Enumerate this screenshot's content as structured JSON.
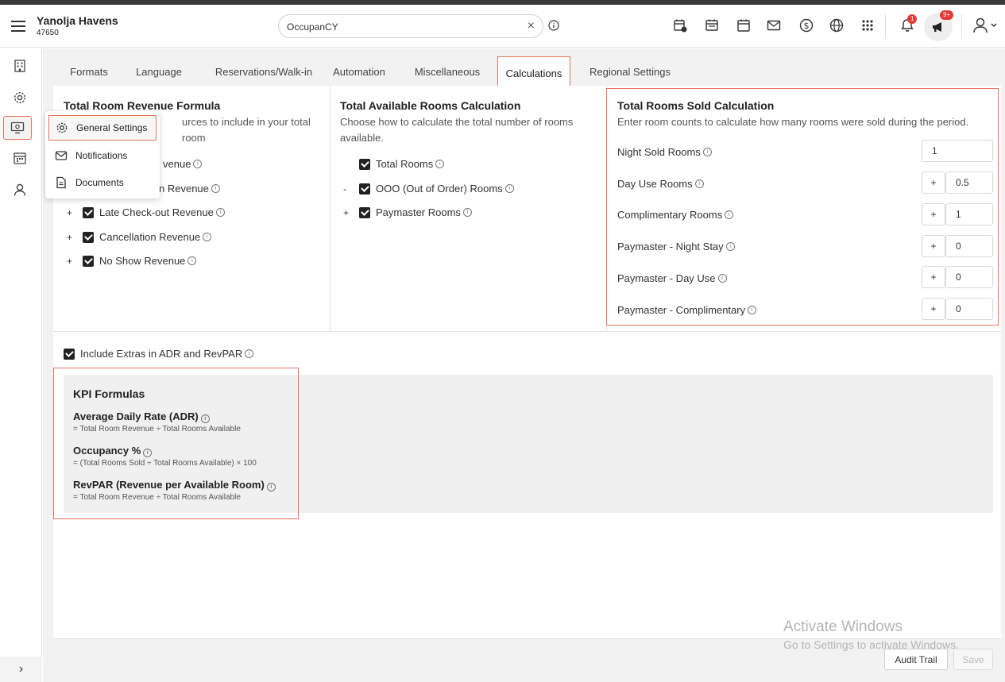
{
  "header": {
    "hotel_name": "Yanolja Havens",
    "hotel_id": "47650",
    "search_value": "OccupanCY",
    "notification_count": "1",
    "announcement_count": "9+"
  },
  "tabs": [
    "Formats",
    "Language",
    "Reservations/Walk-in",
    "Automation",
    "Miscellaneous",
    "Calculations",
    "Regional Settings"
  ],
  "active_tab": "Calculations",
  "menu": {
    "items": [
      {
        "label": "General Settings",
        "icon": "gear-icon"
      },
      {
        "label": "Notifications",
        "icon": "mail-icon"
      },
      {
        "label": "Documents",
        "icon": "document-icon"
      }
    ]
  },
  "revenue": {
    "title": "Total Room Revenue Formula",
    "desc_partial": "urces to include in your total room",
    "items": [
      {
        "sign": "",
        "label": "venue"
      },
      {
        "sign": "",
        "label": "n Revenue"
      },
      {
        "sign": "+",
        "label": "Late Check-out Revenue"
      },
      {
        "sign": "+",
        "label": "Cancellation Revenue"
      },
      {
        "sign": "+",
        "label": "No Show Revenue"
      }
    ]
  },
  "available": {
    "title": "Total Available Rooms Calculation",
    "desc": "Choose how to calculate the total number of rooms available.",
    "items": [
      {
        "sign": "",
        "label": "Total Rooms"
      },
      {
        "sign": "-",
        "label": "OOO (Out of Order) Rooms"
      },
      {
        "sign": "+",
        "label": "Paymaster Rooms"
      }
    ]
  },
  "sold": {
    "title": "Total Rooms Sold Calculation",
    "desc": "Enter room counts to calculate how many rooms were sold during the period.",
    "rows": [
      {
        "label": "Night Sold Rooms",
        "sign": "",
        "value": "1"
      },
      {
        "label": "Day Use Rooms",
        "sign": "+",
        "value": "0.5"
      },
      {
        "label": "Complimentary Rooms",
        "sign": "+",
        "value": "1"
      },
      {
        "label": "Paymaster - Night Stay",
        "sign": "+",
        "value": "0"
      },
      {
        "label": "Paymaster - Day Use",
        "sign": "+",
        "value": "0"
      },
      {
        "label": "Paymaster - Complimentary",
        "sign": "+",
        "value": "0"
      }
    ]
  },
  "include_extras": "Include Extras in ADR and RevPAR",
  "kpi": {
    "title": "KPI Formulas",
    "items": [
      {
        "name": "Average Daily Rate (ADR)",
        "formula": "= Total Room Revenue ÷ Total Rooms Available"
      },
      {
        "name": "Occupancy %",
        "formula": "= (Total Rooms Sold ÷ Total Rooms Available) × 100"
      },
      {
        "name": "RevPAR (Revenue per Available Room)",
        "formula": "= Total Room Revenue ÷ Total Rooms Available"
      }
    ]
  },
  "footer": {
    "audit_label": "Audit Trail",
    "save_label": "Save"
  },
  "watermark": {
    "line1": "Activate Windows",
    "line2": "Go to Settings to activate Windows."
  },
  "colors": {
    "highlight": "#e8735a",
    "badge": "#e53935"
  }
}
